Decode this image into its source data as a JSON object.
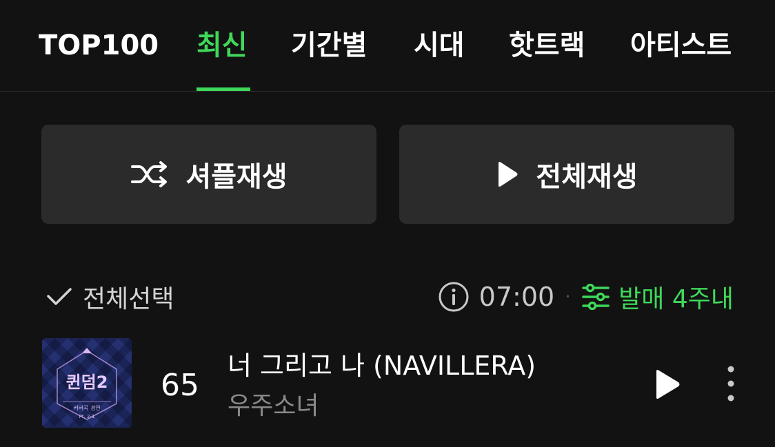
{
  "tabs": [
    {
      "label": "TOP100",
      "active": false
    },
    {
      "label": "최신",
      "active": true
    },
    {
      "label": "기간별",
      "active": false
    },
    {
      "label": "시대",
      "active": false
    },
    {
      "label": "핫트랙",
      "active": false
    },
    {
      "label": "아티스트",
      "active": false
    }
  ],
  "actions": {
    "shuffle_label": "셔플재생",
    "shuffle_icon": "shuffle-icon",
    "play_all_label": "전체재생",
    "play_all_icon": "play-icon"
  },
  "list_header": {
    "select_all_label": "전체선택",
    "select_all_icon": "checkmark-icon",
    "info_icon": "info-icon",
    "update_time": "07:00",
    "separator": "·",
    "filter_icon": "sliders-icon",
    "filter_label": "발매 4주내"
  },
  "tracks": [
    {
      "rank": "65",
      "title": "너 그리고 나 (NAVILLERA)",
      "artist": "우주소녀",
      "album_art_text": "퀸덤2",
      "album_art_subtext": "커버곡 경연",
      "album_art_part": "Pt. 2-1"
    }
  ],
  "colors": {
    "background": "#121212",
    "accent": "#3fd85a",
    "button_bg": "#2b2b2b",
    "secondary_text": "#8a8a8a",
    "divider": "#2c2c2c"
  }
}
